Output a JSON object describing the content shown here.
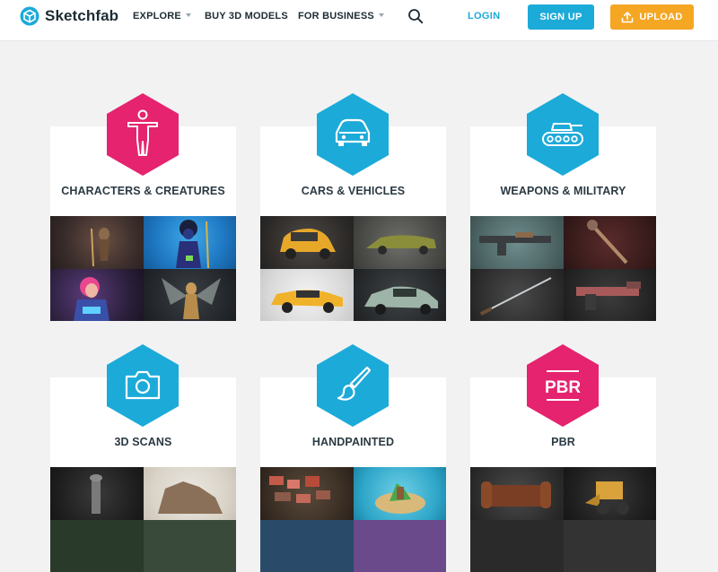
{
  "header": {
    "brand": "Sketchfab",
    "nav": [
      {
        "label": "EXPLORE",
        "dropdown": true
      },
      {
        "label": "BUY 3D MODELS",
        "dropdown": false
      },
      {
        "label": "FOR BUSINESS",
        "dropdown": true
      }
    ],
    "login": "LOGIN",
    "signup": "SIGN UP",
    "upload": "UPLOAD"
  },
  "categories": [
    {
      "title": "CHARACTERS & CREATURES",
      "icon": "person-icon",
      "color": "#e5236f"
    },
    {
      "title": "CARS & VEHICLES",
      "icon": "car-icon",
      "color": "#1caad9"
    },
    {
      "title": "WEAPONS & MILITARY",
      "icon": "tank-icon",
      "color": "#1caad9"
    },
    {
      "title": "3D SCANS",
      "icon": "camera-icon",
      "color": "#1caad9"
    },
    {
      "title": "HANDPAINTED",
      "icon": "paintbrush-icon",
      "color": "#1caad9"
    },
    {
      "title": "PBR",
      "icon": "pbr-icon",
      "icon_text": "PBR",
      "color": "#e5236f"
    }
  ],
  "colors": {
    "brand_blue": "#1caad9",
    "upload_orange": "#f5a623",
    "pink": "#e5236f",
    "page_bg": "#f2f2f3"
  }
}
